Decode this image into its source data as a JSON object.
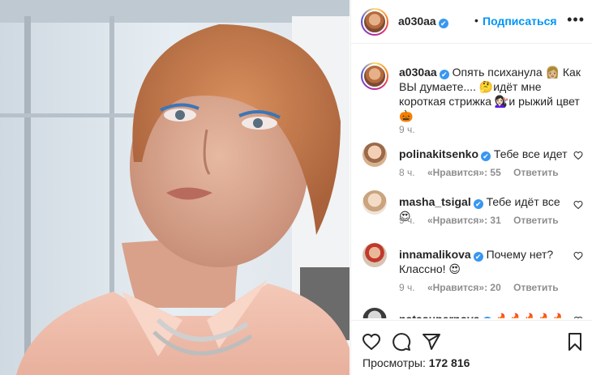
{
  "post": {
    "username": "a030aa",
    "verified_mark": "✔",
    "separator": "•",
    "follow_label": "Подписаться",
    "more_label": "•••"
  },
  "caption": {
    "username": "a030aa",
    "text": "Опять психанула 👩🏼 Как ВЫ думаете.... 🤔идёт мне короткая стрижка 💇🏻‍♀️и рыжий цвет 🎃",
    "time": "9 ч."
  },
  "comments": [
    {
      "username": "polinakitsenko",
      "text": "Тебе все идет",
      "time": "8 ч.",
      "likes": "«Нравится»: 55",
      "reply": "Ответить"
    },
    {
      "username": "masha_tsigal",
      "text": "Тебе идёт все 😍",
      "time": "9 ч.",
      "likes": "«Нравится»: 31",
      "reply": "Ответить"
    },
    {
      "username": "innamalikova",
      "text": "Почему нет? Классно! 😍",
      "time": "9 ч.",
      "likes": "«Нравится»: 20",
      "reply": "Ответить"
    },
    {
      "username": "natasupernova",
      "text": "🔥🔥🔥🔥🔥🔥🔥"
    }
  ],
  "actions": {
    "views_label": "Просмотры:",
    "views_count": "172 816",
    "icons": [
      "heart-icon",
      "comment-icon",
      "share-icon",
      "bookmark-icon"
    ]
  },
  "colors": {
    "accent": "#0095f6",
    "verified": "#3897f0",
    "muted": "#8e8e8e",
    "text": "#262626"
  }
}
